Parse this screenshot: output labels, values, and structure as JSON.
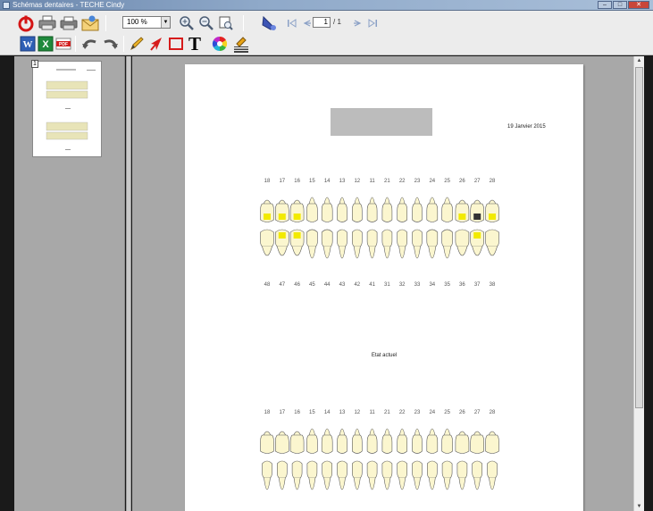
{
  "window": {
    "title": "Schémas dentaires - TECHE Cindy",
    "min_label": "–",
    "max_label": "□",
    "close_label": "✕"
  },
  "toolbar": {
    "zoom_value": "100 %",
    "page_current": "1",
    "page_total": "/ 1",
    "text_tool_label": "T",
    "word_label": "W",
    "excel_label": "X",
    "pdf_label": "PDF"
  },
  "thumbnail": {
    "page_number": "1"
  },
  "document": {
    "date": "19 Janvier 2015",
    "caption": "Etat actuel",
    "chart1": {
      "upper_numbers": [
        "18",
        "17",
        "16",
        "15",
        "14",
        "13",
        "12",
        "11",
        "21",
        "22",
        "23",
        "24",
        "25",
        "26",
        "27",
        "28"
      ],
      "lower_numbers": [
        "48",
        "47",
        "46",
        "45",
        "44",
        "43",
        "42",
        "41",
        "31",
        "32",
        "33",
        "34",
        "35",
        "36",
        "37",
        "38"
      ],
      "upper_marks": [
        {
          "tooth": "18",
          "color": "#f2ea00"
        },
        {
          "tooth": "17",
          "color": "#f2ea00"
        },
        {
          "tooth": "16",
          "color": "#f2ea00"
        },
        {
          "tooth": "26",
          "color": "#f2ea00"
        },
        {
          "tooth": "27",
          "color": "#333333"
        },
        {
          "tooth": "28",
          "color": "#f2ea00"
        }
      ],
      "lower_marks": [
        {
          "tooth": "47",
          "color": "#f2ea00"
        },
        {
          "tooth": "46",
          "color": "#f2ea00"
        },
        {
          "tooth": "37",
          "color": "#f2ea00"
        }
      ]
    },
    "chart2": {
      "upper_numbers": [
        "18",
        "17",
        "16",
        "15",
        "14",
        "13",
        "12",
        "11",
        "21",
        "22",
        "23",
        "24",
        "25",
        "26",
        "27",
        "28"
      ]
    }
  },
  "colors": {
    "tooth_fill": "#fbf6cf",
    "tooth_stroke": "#5a5a5a",
    "filling_yellow": "#f2ea00",
    "crown_dark": "#333333"
  }
}
